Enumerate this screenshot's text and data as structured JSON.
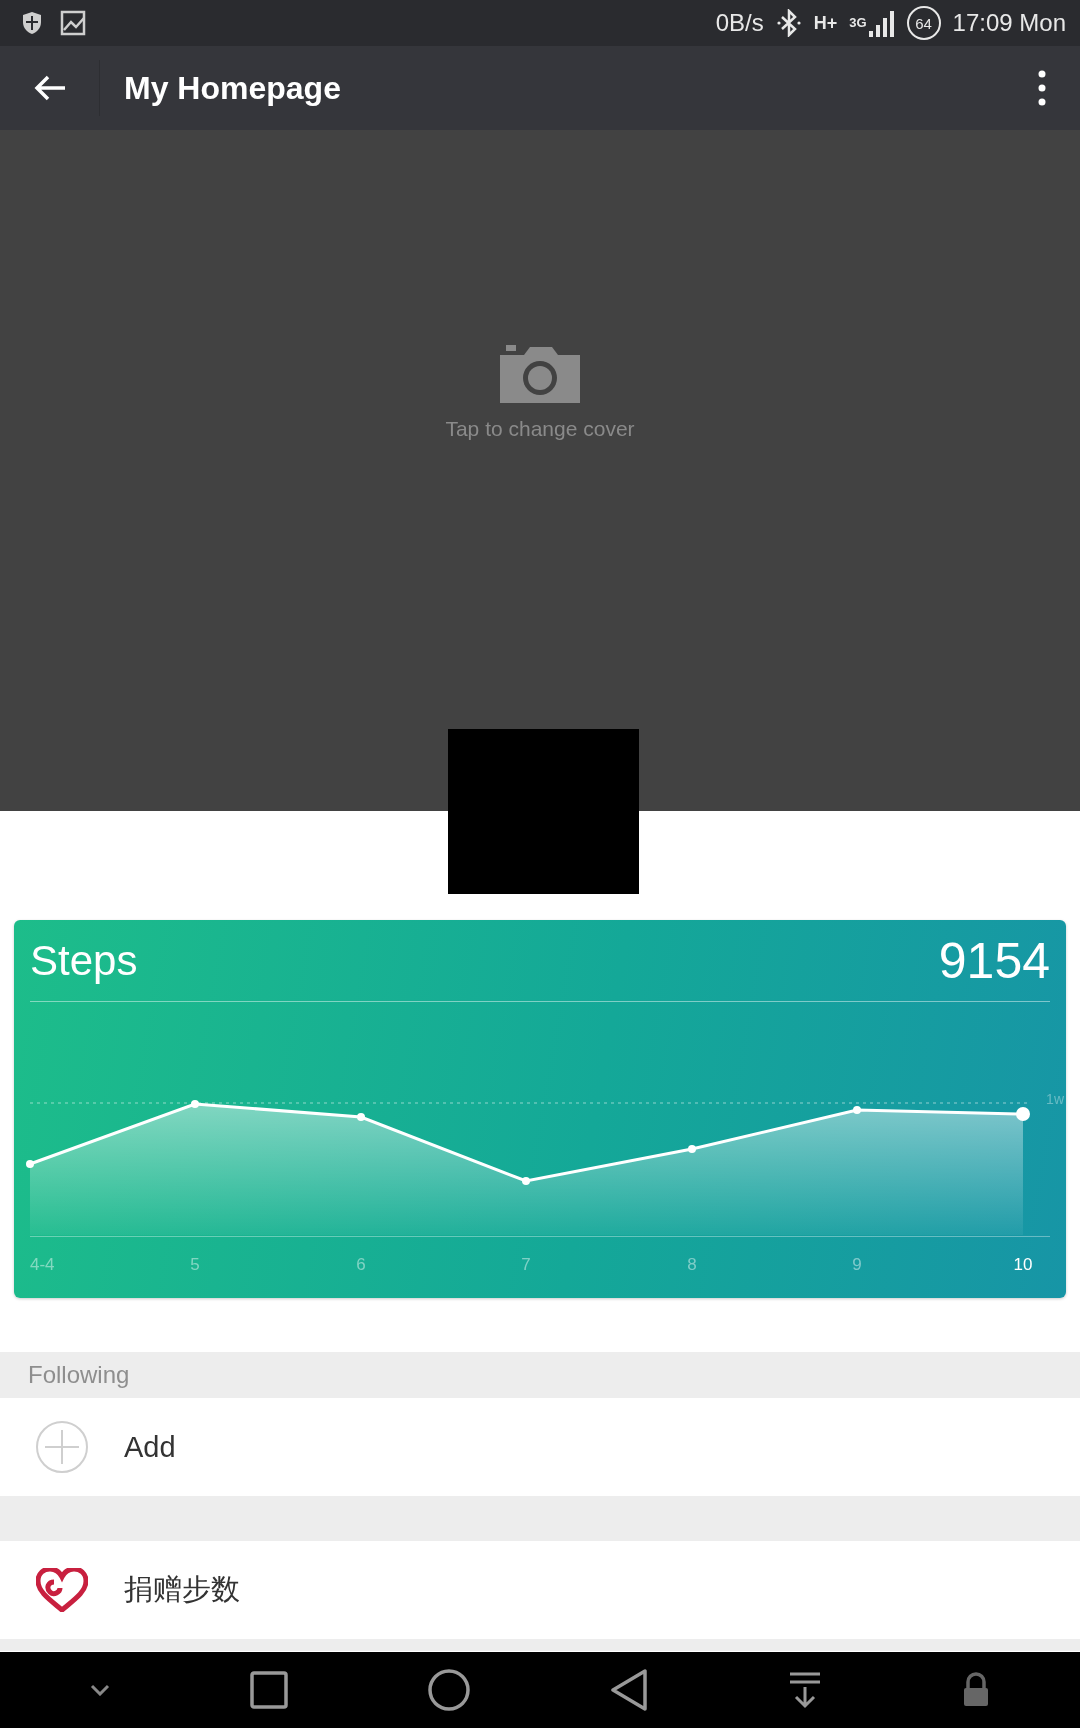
{
  "status_bar": {
    "speed": "0B/s",
    "network": "H+",
    "generation": "3G",
    "battery": "64",
    "time": "17:09 Mon"
  },
  "toolbar": {
    "title": "My Homepage"
  },
  "cover": {
    "hint": "Tap to change cover"
  },
  "steps_card": {
    "title": "Steps",
    "value": "9154",
    "reference_label": "1w",
    "x_labels": [
      {
        "label": "4-4",
        "selected": false
      },
      {
        "label": "5",
        "selected": false
      },
      {
        "label": "6",
        "selected": false
      },
      {
        "label": "7",
        "selected": false
      },
      {
        "label": "8",
        "selected": false
      },
      {
        "label": "9",
        "selected": false
      },
      {
        "label": "10",
        "selected": true
      }
    ]
  },
  "following": {
    "header": "Following",
    "add_label": "Add"
  },
  "donation": {
    "label": "捐赠步数"
  }
}
